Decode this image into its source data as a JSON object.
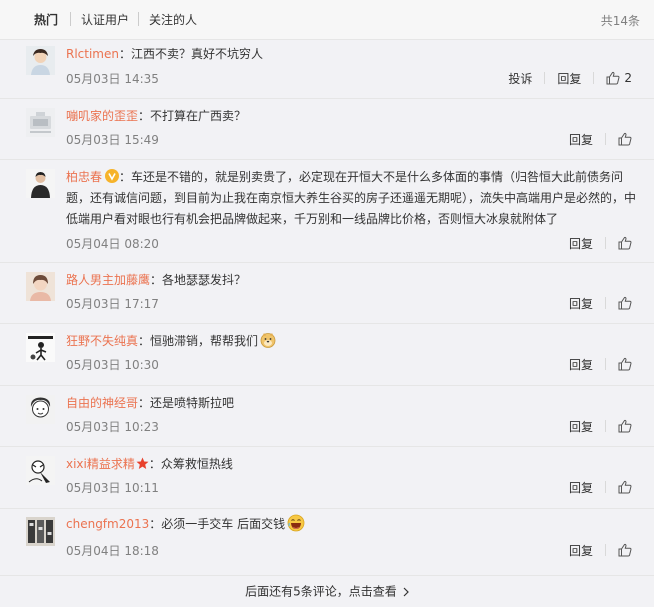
{
  "tabs": [
    {
      "label": "热门",
      "active": true
    },
    {
      "label": "认证用户",
      "active": false
    },
    {
      "label": "关注的人",
      "active": false
    }
  ],
  "total_label": "共14条",
  "comments": [
    {
      "user": "Rlctimen",
      "text": "江西不卖？真好不坑穷人",
      "time": "05月03日 14:35",
      "report": "投诉",
      "reply": "回复",
      "likes": "2"
    },
    {
      "user": "嘣叽家的歪歪",
      "text": "不打算在广西卖？",
      "time": "05月03日 15:49",
      "reply": "回复"
    },
    {
      "user": "柏忠春",
      "verified": true,
      "text": "车还是不错的，就是别卖贵了，必定现在开恒大不是什么多体面的事情（归咎恒大此前债务问题，还有诚信问题，到目前为止我在南京恒大养生谷买的房子还遥遥无期呢），流失中高端用户是必然的，中低端用户看对眼也行有机会把品牌做起来，千万别和一线品牌比价格，否则恒大冰泉就附体了",
      "time": "05月04日 08:20",
      "reply": "回复"
    },
    {
      "user": "路人男主加藤鹰",
      "text": "各地瑟瑟发抖？",
      "time": "05月03日 17:17",
      "reply": "回复"
    },
    {
      "user": "狂野不失纯真",
      "text": "恒驰滞销，帮帮我们",
      "emoji": "doge-emoji",
      "time": "05月03日 10:30",
      "reply": "回复"
    },
    {
      "user": "自由的神经哥",
      "text": "还是喷特斯拉吧",
      "time": "05月03日 10:23",
      "reply": "回复"
    },
    {
      "user": "xixi精益求精",
      "star": true,
      "text": "众筹救恒热线",
      "time": "05月03日 10:11",
      "reply": "回复"
    },
    {
      "user": "chengfm2013",
      "text": "必须一手交车 后面交钱",
      "emoji": "laugh-emoji",
      "time": "05月04日 18:18",
      "reply": "回复"
    }
  ],
  "footer": {
    "more_label": "后面还有5条评论，点击查看"
  },
  "colors": {
    "username": "#eb7350",
    "background": "#f2f2f5",
    "time": "#808080",
    "badge": "#f6b32a"
  }
}
